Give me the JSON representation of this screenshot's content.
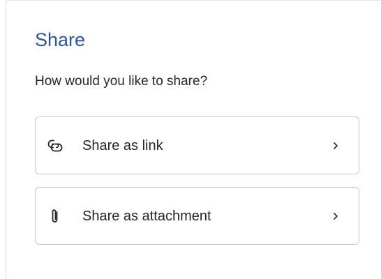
{
  "share_panel": {
    "title": "Share",
    "subtitle": "How would you like to share?",
    "options": [
      {
        "label": "Share as link",
        "icon": "link-icon"
      },
      {
        "label": "Share as attachment",
        "icon": "paperclip-icon"
      }
    ]
  },
  "colors": {
    "title": "#2b579a",
    "text": "#262626",
    "border": "#c8c8c8"
  }
}
